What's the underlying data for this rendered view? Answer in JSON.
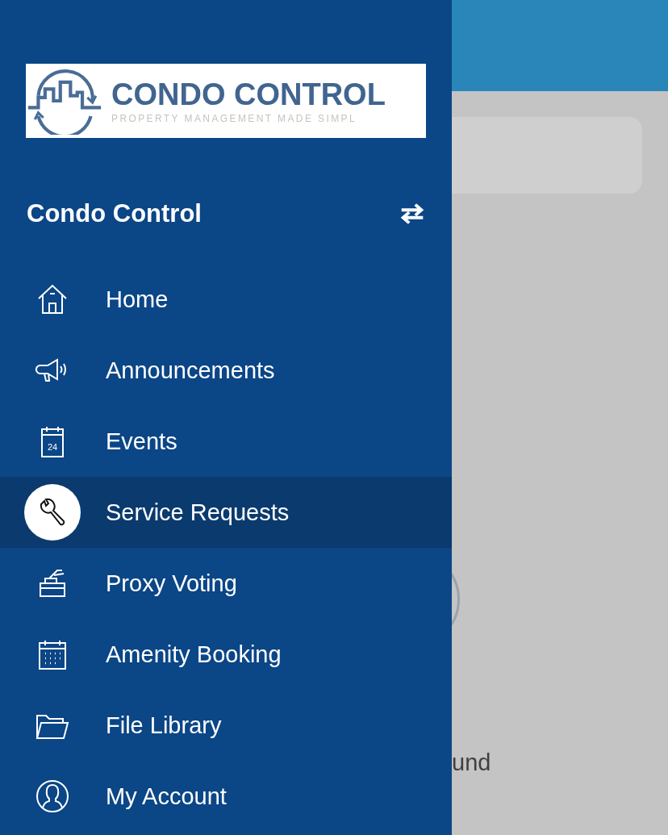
{
  "logo": {
    "title": "CONDO CONTROL",
    "tagline": "PROPERTY MANAGEMENT MADE SIMPL"
  },
  "account": {
    "name": "Condo Control"
  },
  "menu": [
    {
      "label": "Home",
      "kind": "home",
      "selected": false
    },
    {
      "label": "Announcements",
      "kind": "megaphone",
      "selected": false
    },
    {
      "label": "Events",
      "kind": "calendar-day",
      "selected": false,
      "day": "24"
    },
    {
      "label": "Service Requests",
      "kind": "wrench",
      "selected": true
    },
    {
      "label": "Proxy Voting",
      "kind": "ballot",
      "selected": false
    },
    {
      "label": "Amenity Booking",
      "kind": "calendar-grid",
      "selected": false
    },
    {
      "label": "File Library",
      "kind": "folder",
      "selected": false
    },
    {
      "label": "My Account",
      "kind": "user",
      "selected": false
    }
  ],
  "background": {
    "text": "und"
  }
}
